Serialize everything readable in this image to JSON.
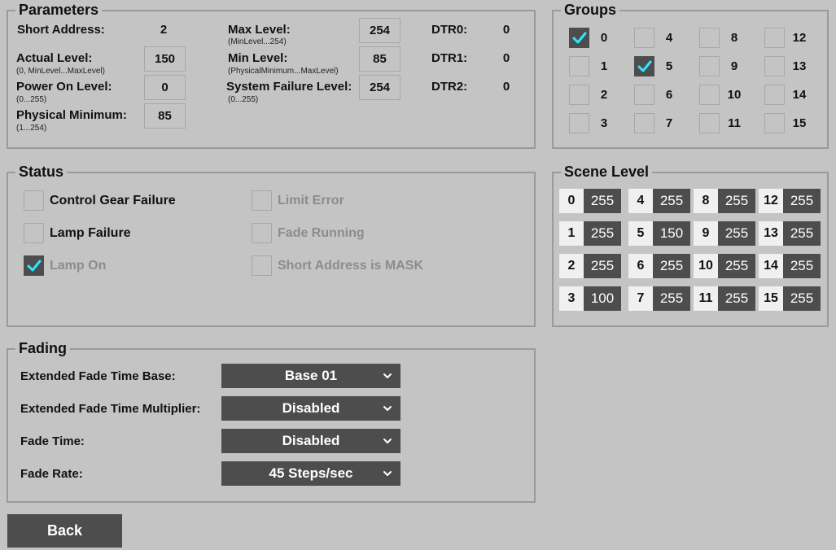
{
  "parameters": {
    "title": "Parameters",
    "short_address_label": "Short Address:",
    "short_address_value": "2",
    "actual_level_label": "Actual Level:",
    "actual_level_hint": "(0, MinLevel...MaxLevel)",
    "actual_level_value": "150",
    "power_on_level_label": "Power On Level:",
    "power_on_level_hint": "(0...255)",
    "power_on_level_value": "0",
    "physical_minimum_label": "Physical Minimum:",
    "physical_minimum_hint": "(1...254)",
    "physical_minimum_value": "85",
    "max_level_label": "Max Level:",
    "max_level_hint": "(MinLevel...254)",
    "max_level_value": "254",
    "min_level_label": "Min Level:",
    "min_level_hint": "(PhysicalMinimum...MaxLevel)",
    "min_level_value": "85",
    "system_failure_level_label": "System Failure Level:",
    "system_failure_level_hint": "(0...255)",
    "system_failure_level_value": "254",
    "dtr0_label": "DTR0:",
    "dtr0_value": "0",
    "dtr1_label": "DTR1:",
    "dtr1_value": "0",
    "dtr2_label": "DTR2:",
    "dtr2_value": "0"
  },
  "groups": {
    "title": "Groups",
    "items": [
      {
        "label": "0",
        "checked": true
      },
      {
        "label": "1",
        "checked": false
      },
      {
        "label": "2",
        "checked": false
      },
      {
        "label": "3",
        "checked": false
      },
      {
        "label": "4",
        "checked": false
      },
      {
        "label": "5",
        "checked": true
      },
      {
        "label": "6",
        "checked": false
      },
      {
        "label": "7",
        "checked": false
      },
      {
        "label": "8",
        "checked": false
      },
      {
        "label": "9",
        "checked": false
      },
      {
        "label": "10",
        "checked": false
      },
      {
        "label": "11",
        "checked": false
      },
      {
        "label": "12",
        "checked": false
      },
      {
        "label": "13",
        "checked": false
      },
      {
        "label": "14",
        "checked": false
      },
      {
        "label": "15",
        "checked": false
      }
    ]
  },
  "status": {
    "title": "Status",
    "items": [
      {
        "label": "Control Gear Failure",
        "checked": false,
        "enabled": true
      },
      {
        "label": "Lamp Failure",
        "checked": false,
        "enabled": true
      },
      {
        "label": "Lamp On",
        "checked": true,
        "enabled": false
      },
      {
        "label": "Limit Error",
        "checked": false,
        "enabled": false
      },
      {
        "label": "Fade Running",
        "checked": false,
        "enabled": false
      },
      {
        "label": "Short Address is MASK",
        "checked": false,
        "enabled": false
      }
    ]
  },
  "scene_level": {
    "title": "Scene Level",
    "items": [
      {
        "scene": "0",
        "value": "255"
      },
      {
        "scene": "1",
        "value": "255"
      },
      {
        "scene": "2",
        "value": "255"
      },
      {
        "scene": "3",
        "value": "100"
      },
      {
        "scene": "4",
        "value": "255"
      },
      {
        "scene": "5",
        "value": "150"
      },
      {
        "scene": "6",
        "value": "255"
      },
      {
        "scene": "7",
        "value": "255"
      },
      {
        "scene": "8",
        "value": "255"
      },
      {
        "scene": "9",
        "value": "255"
      },
      {
        "scene": "10",
        "value": "255"
      },
      {
        "scene": "11",
        "value": "255"
      },
      {
        "scene": "12",
        "value": "255"
      },
      {
        "scene": "13",
        "value": "255"
      },
      {
        "scene": "14",
        "value": "255"
      },
      {
        "scene": "15",
        "value": "255"
      }
    ]
  },
  "fading": {
    "title": "Fading",
    "rows": [
      {
        "label": "Extended Fade Time Base:",
        "value": "Base 01"
      },
      {
        "label": "Extended Fade Time Multiplier:",
        "value": "Disabled"
      },
      {
        "label": "Fade Time:",
        "value": "Disabled"
      },
      {
        "label": "Fade Rate:",
        "value": "45 Steps/sec"
      }
    ]
  },
  "back_button_label": "Back",
  "colors": {
    "background": "#c4c4c4",
    "dark_control": "#4d4d4d",
    "check_accent": "#2ee6ff",
    "disabled_text": "#8c8c8c"
  },
  "icons": {
    "checkmark": "checkmark-icon",
    "dropdown": "chevron-down-icon"
  }
}
